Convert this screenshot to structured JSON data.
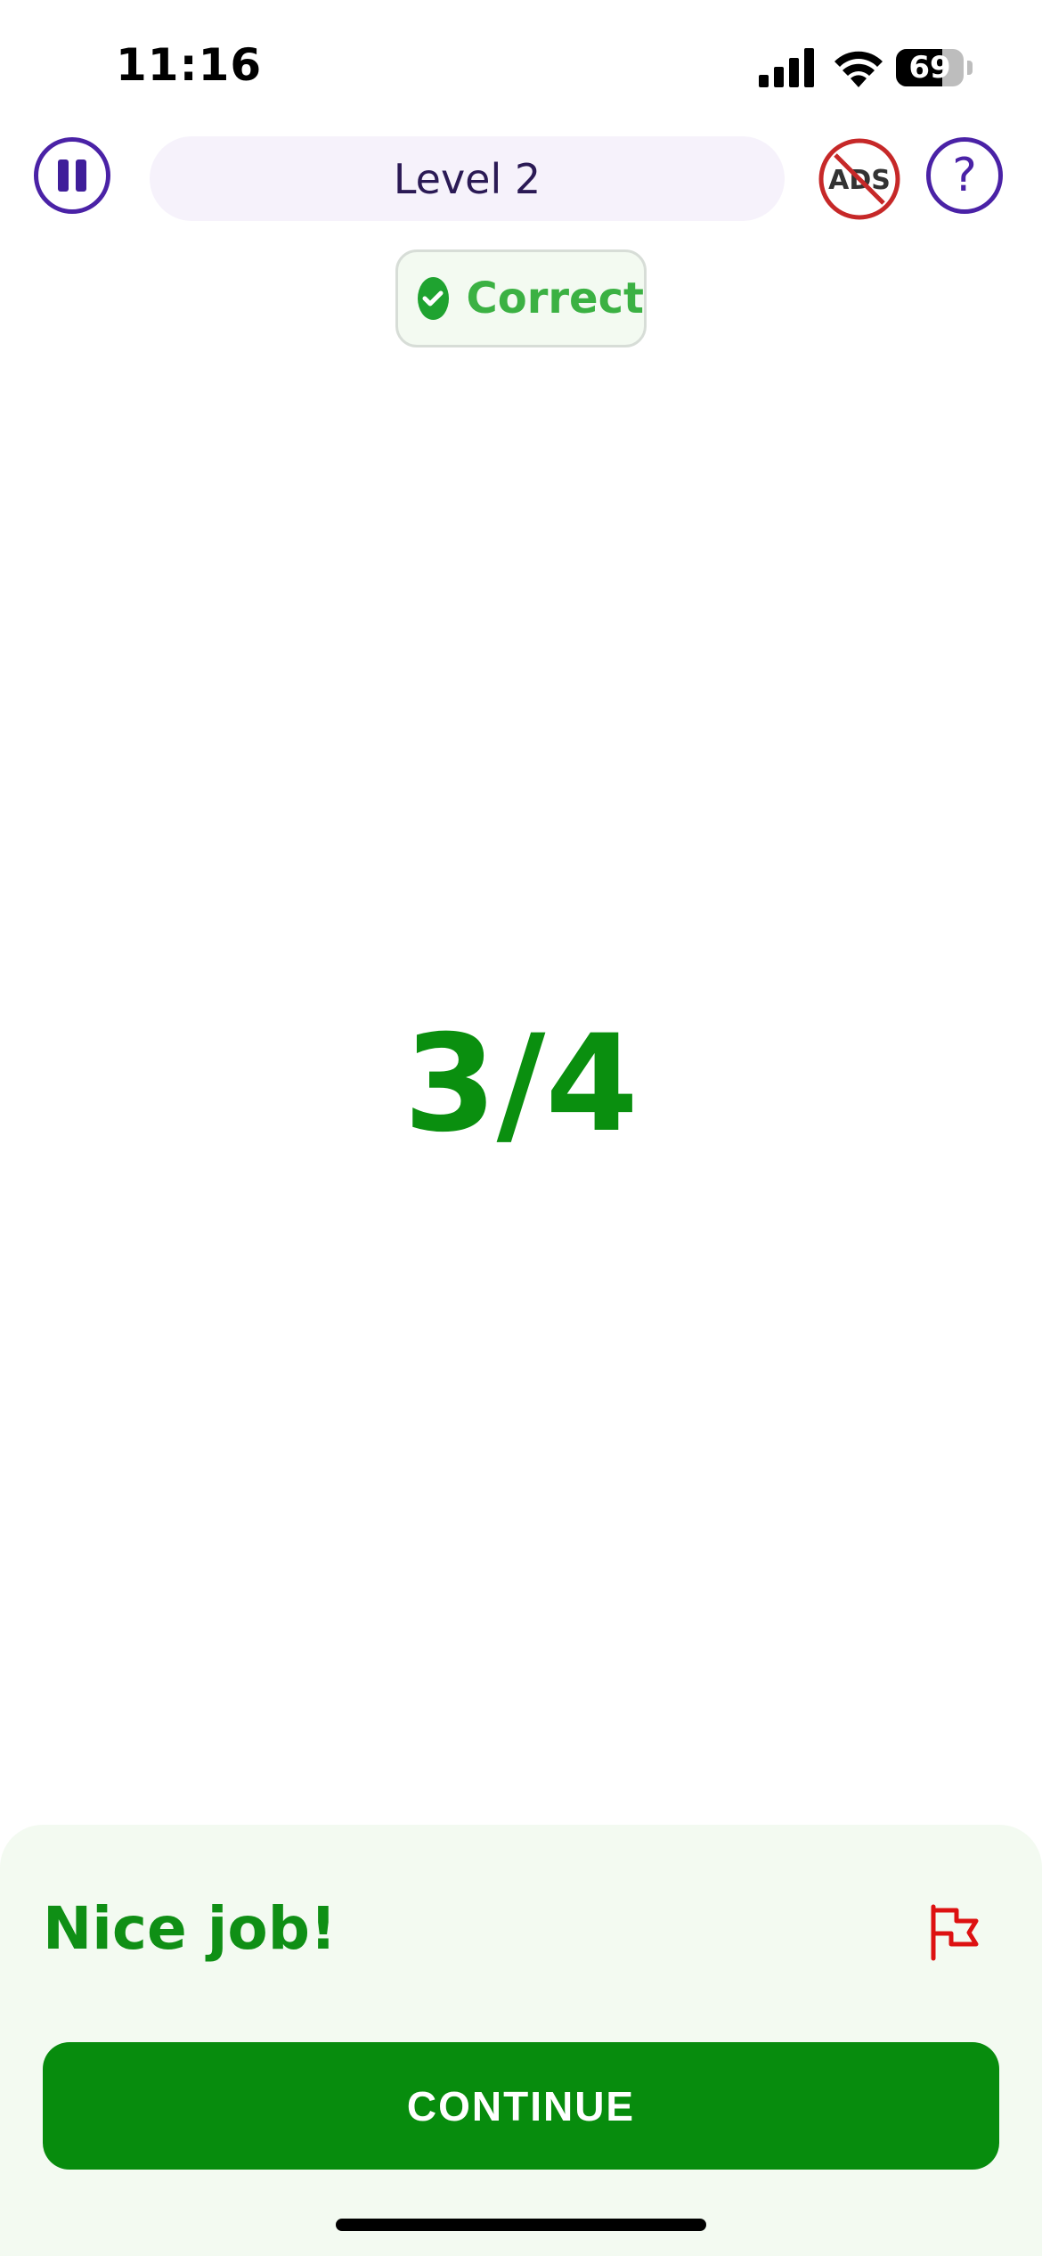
{
  "status_bar": {
    "time": "11:16",
    "battery_level": "69"
  },
  "top_bar": {
    "level_label": "Level 2",
    "pause_icon": "pause-icon",
    "no_ads_icon": "no-ads-icon",
    "no_ads_text": "ADS",
    "help_text": "?"
  },
  "result": {
    "status": "Correct",
    "answer": "3/4"
  },
  "bottom_sheet": {
    "message": "Nice job!",
    "report_icon": "flag-icon",
    "continue_label": "CONTINUE"
  },
  "colors": {
    "accent_purple": "#4a22a6",
    "success_green": "#0a8f0f",
    "sheet_bg": "#f3faf1",
    "no_ads_red": "#c62828"
  }
}
